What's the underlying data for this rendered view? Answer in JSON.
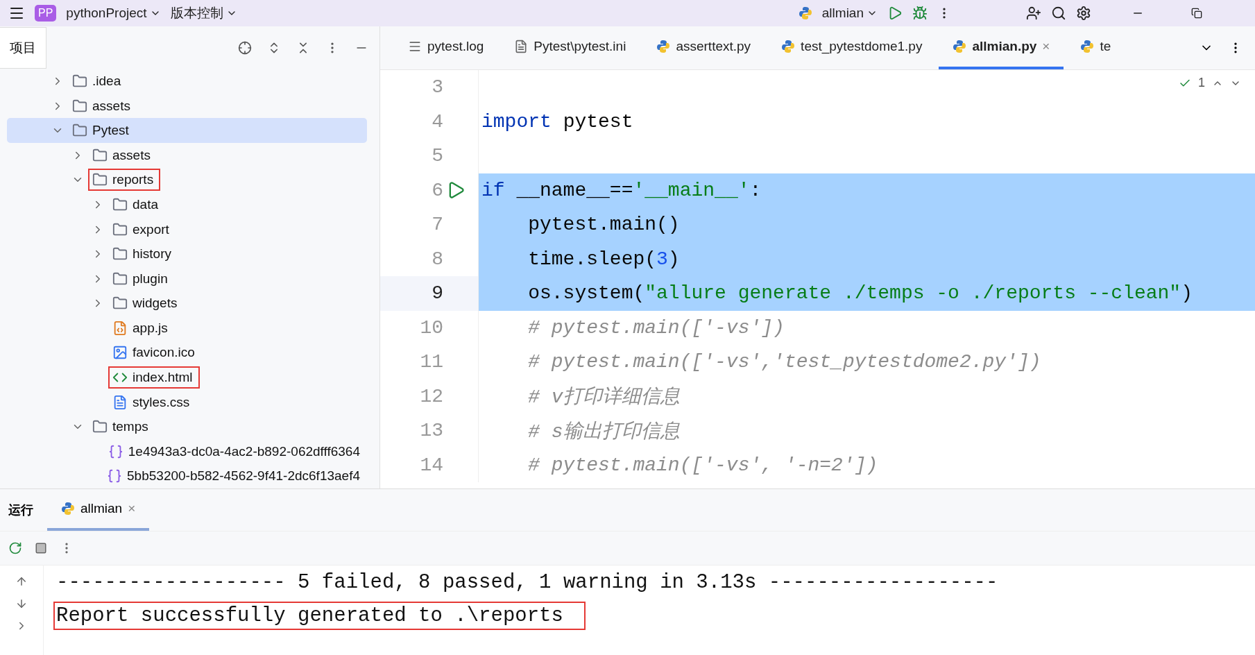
{
  "title_bar": {
    "project_badge": "PP",
    "project": "pythonProject",
    "vcs": "版本控制",
    "run_config": "allmian"
  },
  "project_panel": {
    "tab": "项目",
    "tree": [
      {
        "name": ".idea",
        "kind": "folder",
        "expanded": false,
        "selected": false,
        "highlighted": false
      },
      {
        "name": "assets",
        "kind": "folder",
        "expanded": false,
        "selected": false,
        "highlighted": false
      },
      {
        "name": "Pytest",
        "kind": "folder",
        "expanded": true,
        "selected": true,
        "highlighted": false,
        "children": [
          {
            "name": "assets",
            "kind": "folder",
            "expanded": false,
            "selected": false,
            "highlighted": false
          },
          {
            "name": "reports",
            "kind": "folder",
            "expanded": true,
            "selected": false,
            "highlighted": true,
            "children": [
              {
                "name": "data",
                "kind": "folder",
                "expanded": false,
                "selected": false,
                "highlighted": false
              },
              {
                "name": "export",
                "kind": "folder",
                "expanded": false,
                "selected": false,
                "highlighted": false
              },
              {
                "name": "history",
                "kind": "folder",
                "expanded": false,
                "selected": false,
                "highlighted": false
              },
              {
                "name": "plugin",
                "kind": "folder",
                "expanded": false,
                "selected": false,
                "highlighted": false
              },
              {
                "name": "widgets",
                "kind": "folder",
                "expanded": false,
                "selected": false,
                "highlighted": false
              },
              {
                "name": "app.js",
                "kind": "js",
                "selected": false,
                "highlighted": false
              },
              {
                "name": "favicon.ico",
                "kind": "image",
                "selected": false,
                "highlighted": false
              },
              {
                "name": "index.html",
                "kind": "html",
                "selected": false,
                "highlighted": true
              },
              {
                "name": "styles.css",
                "kind": "css",
                "selected": false,
                "highlighted": false
              }
            ]
          },
          {
            "name": "temps",
            "kind": "folder",
            "expanded": true,
            "selected": false,
            "highlighted": false,
            "children": [
              {
                "name": "1e4943a3-dc0a-4ac2-b892-062dfff6364",
                "kind": "json",
                "selected": false,
                "highlighted": false
              },
              {
                "name": "5bb53200-b582-4562-9f41-2dc6f13aef4",
                "kind": "json",
                "selected": false,
                "highlighted": false
              }
            ]
          }
        ]
      }
    ]
  },
  "editor_tabs": [
    {
      "label": "pytest.log",
      "kind": "log",
      "selected": false
    },
    {
      "label": "Pytest\\pytest.ini",
      "kind": "ini",
      "selected": false
    },
    {
      "label": "asserttext.py",
      "kind": "python",
      "selected": false
    },
    {
      "label": "test_pytestdome1.py",
      "kind": "python",
      "selected": false
    },
    {
      "label": "allmian.py",
      "kind": "python",
      "selected": true,
      "close": "×"
    },
    {
      "label": "te",
      "kind": "python",
      "selected": false
    }
  ],
  "editor": {
    "inspection_count": "1",
    "lines": [
      {
        "number": "3",
        "selected": false,
        "current": false
      },
      {
        "number": "4",
        "selected": false,
        "current": false,
        "tokens": [
          {
            "kind": "keyword",
            "text": "import"
          },
          {
            "kind": "plain",
            "text": " pytest"
          }
        ]
      },
      {
        "number": "5",
        "selected": false,
        "current": false
      },
      {
        "number": "6",
        "selected": true,
        "current": false,
        "run": true,
        "tokens": [
          {
            "kind": "keyword",
            "text": "if"
          },
          {
            "kind": "plain",
            "text": " __name__=="
          },
          {
            "kind": "string",
            "text": "'__main__'"
          },
          {
            "kind": "plain",
            "text": ":"
          }
        ]
      },
      {
        "number": "7",
        "selected": true,
        "current": false,
        "tokens": [
          {
            "kind": "plain",
            "text": "    pytest.main()"
          }
        ]
      },
      {
        "number": "8",
        "selected": true,
        "current": false,
        "tokens": [
          {
            "kind": "plain",
            "text": "    time.sleep("
          },
          {
            "kind": "number",
            "text": "3"
          },
          {
            "kind": "plain",
            "text": ")"
          }
        ]
      },
      {
        "number": "9",
        "selected": true,
        "current": true,
        "tokens": [
          {
            "kind": "plain",
            "text": "    os.system("
          },
          {
            "kind": "string",
            "text": "\"allure generate ./temps -o ./reports --clean\""
          },
          {
            "kind": "plain",
            "text": ")"
          }
        ]
      },
      {
        "number": "10",
        "selected": false,
        "current": false,
        "tokens": [
          {
            "kind": "comment",
            "text": "    # pytest.main(['-vs'])"
          }
        ]
      },
      {
        "number": "11",
        "selected": false,
        "current": false,
        "tokens": [
          {
            "kind": "comment",
            "text": "    # pytest.main(['-vs','test_pytestdome2.py'])"
          }
        ]
      },
      {
        "number": "12",
        "selected": false,
        "current": false,
        "tokens": [
          {
            "kind": "comment",
            "text": "    # v打印详细信息"
          }
        ]
      },
      {
        "number": "13",
        "selected": false,
        "current": false,
        "tokens": [
          {
            "kind": "comment",
            "text": "    # s输出打印信息"
          }
        ]
      },
      {
        "number": "14",
        "selected": false,
        "current": false,
        "tokens": [
          {
            "kind": "comment",
            "text": "    # pytest.main(['-vs', '-n=2'])"
          }
        ]
      }
    ]
  },
  "run_panel": {
    "title": "运行",
    "tab": {
      "label": "allmian",
      "close": "×",
      "selected": true
    },
    "console": [
      {
        "text": "------------------- 5 failed, 8 passed, 1 warning in 3.13s -------------------",
        "highlighted": false
      },
      {
        "text": "Report successfully generated to .\\reports",
        "highlighted": true
      }
    ]
  }
}
